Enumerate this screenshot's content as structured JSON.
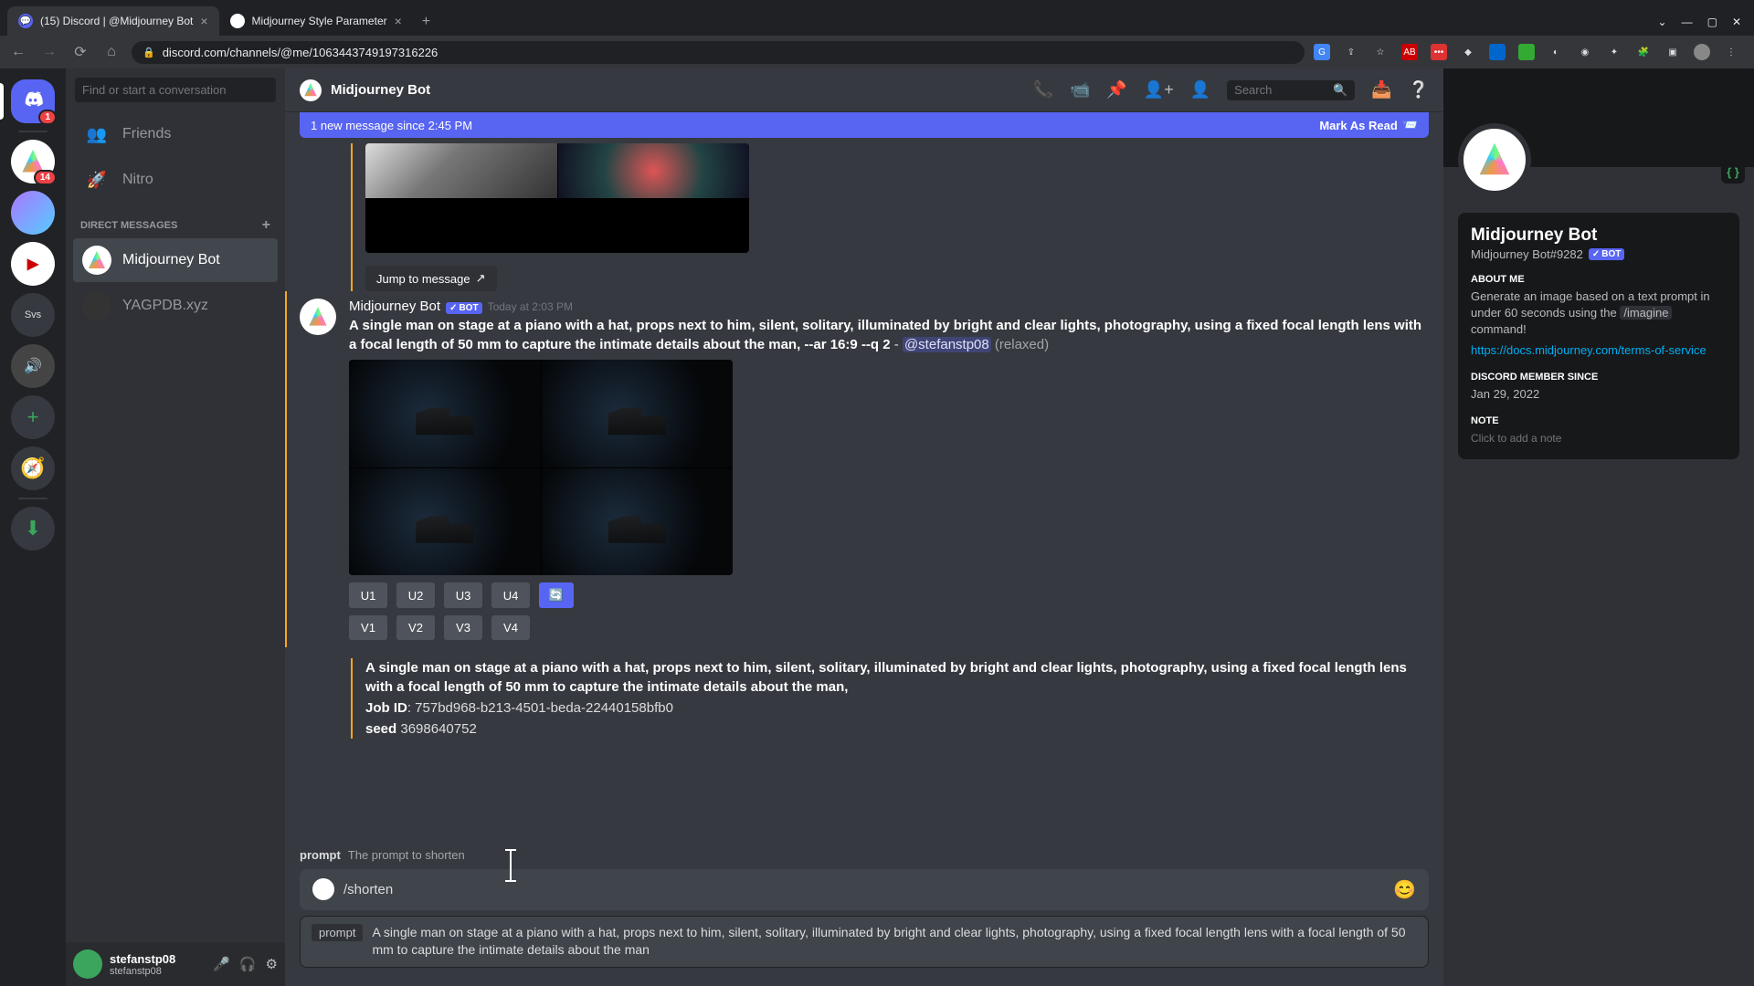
{
  "browser": {
    "tabs": [
      {
        "title": "(15) Discord | @Midjourney Bot"
      },
      {
        "title": "Midjourney Style Parameter"
      }
    ],
    "url": "discord.com/channels/@me/1063443749197316226"
  },
  "servers": {
    "home_badge": "1",
    "s2_badge": "14",
    "svs_label": "Svs"
  },
  "dm": {
    "search_placeholder": "Find or start a conversation",
    "friends": "Friends",
    "nitro": "Nitro",
    "header": "DIRECT MESSAGES",
    "items": [
      "Midjourney Bot",
      "YAGPDB.xyz"
    ]
  },
  "user_panel": {
    "name": "stefanstp08",
    "tag": "stefanstp08"
  },
  "header": {
    "title": "Midjourney Bot",
    "search_placeholder": "Search"
  },
  "banner": {
    "text": "1 new message since 2:45 PM",
    "mark": "Mark As Read"
  },
  "message": {
    "author": "Midjourney Bot",
    "bot_tag": "BOT",
    "time": "Today at 2:03 PM",
    "prompt_bold": "A single man on stage at a piano with a hat, props next to him, silent, solitary, illuminated by bright and clear lights, photography, using a fixed focal length lens with a focal length of 50 mm to capture the intimate details about the man, --ar 16:9 --q 2",
    "dash": " - ",
    "mention": "@stefanstp08",
    "relaxed": " (relaxed)",
    "jump": "Jump to message",
    "buttons_u": [
      "U1",
      "U2",
      "U3",
      "U4"
    ],
    "buttons_v": [
      "V1",
      "V2",
      "V3",
      "V4"
    ],
    "refresh": "🔄"
  },
  "meta": {
    "line1_bold": "A single man on stage at a piano with a hat, props next to him, silent, solitary, illuminated by bright and clear lights, photography, using a fixed focal length lens with a focal length of 50 mm to capture the intimate details about the man,",
    "job_k": "Job ID",
    "job_v": ": 757bd968-b213-4501-beda-22440158bfb0",
    "seed_k": "seed",
    "seed_v": " 3698640752"
  },
  "input": {
    "option_k": "prompt",
    "option_d": "The prompt to shorten",
    "command": "/shorten",
    "param_k": "prompt",
    "param_v": "A single man on stage at a piano with a hat, props next to him, silent, solitary, illuminated by bright and clear lights, photography, using a fixed focal length lens with a focal length of 50 mm to capture the intimate details about the man"
  },
  "profile": {
    "name": "Midjourney Bot",
    "tag": "Midjourney Bot#9282",
    "bot": "BOT",
    "about_h": "ABOUT ME",
    "about_1": "Generate an image based on a text prompt in under 60 seconds using the ",
    "about_cmd": "/imagine",
    "about_2": " command!",
    "about_link": "https://docs.midjourney.com/terms-of-service",
    "since_h": "DISCORD MEMBER SINCE",
    "since_v": "Jan 29, 2022",
    "note_h": "NOTE",
    "note_placeholder": "Click to add a note"
  }
}
